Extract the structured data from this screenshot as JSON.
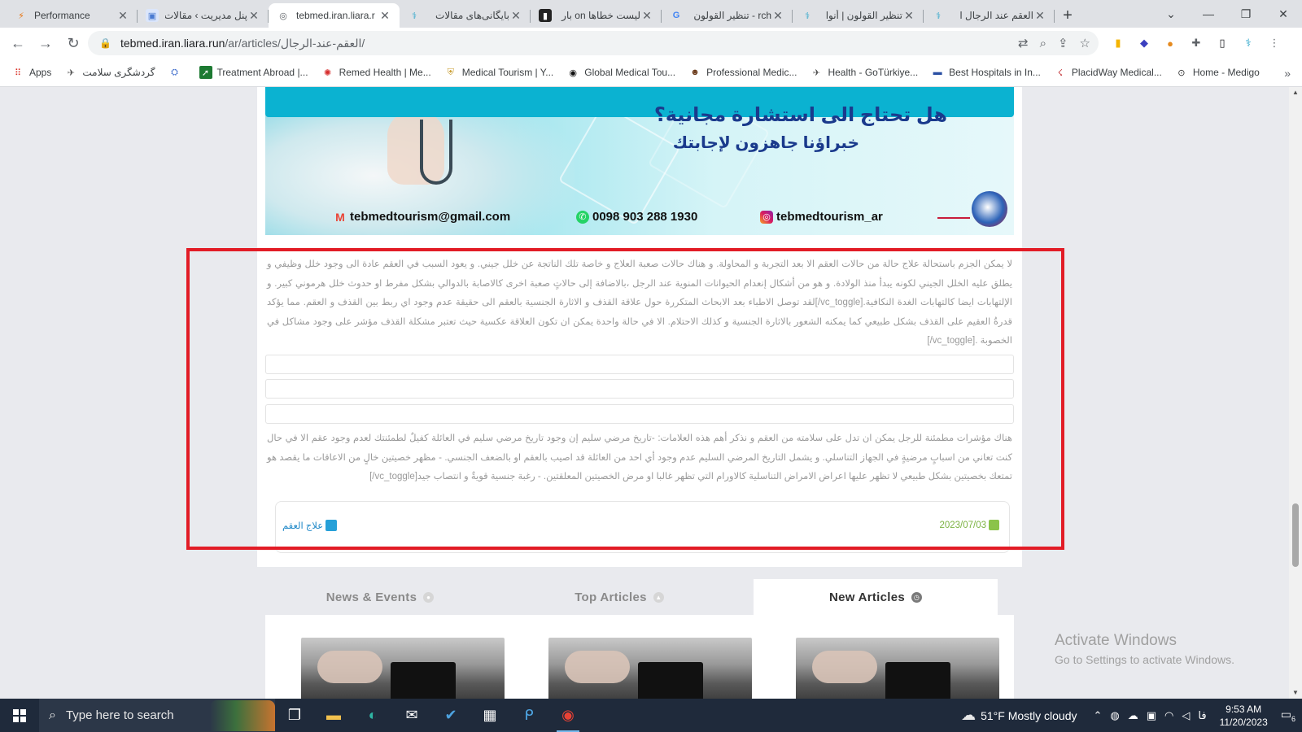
{
  "browser": {
    "tabs": [
      {
        "title": "Performance",
        "icon": "performance-icon",
        "color": "#e8710a"
      },
      {
        "title": "پنل مدیریت › مقالات",
        "icon": "site-icon",
        "color": "#4a7bd1"
      },
      {
        "title": "tebmed.iran.liara.r",
        "icon": "globe-icon",
        "color": "#5f6368",
        "active": true
      },
      {
        "title": "بایگانی‌های مقالات",
        "icon": "tebmed-icon",
        "color": "#27a3c9"
      },
      {
        "title": "لیست خطاها on بار",
        "icon": "doc-icon",
        "color": "#222222"
      },
      {
        "title": "rch - تنظیر القولون",
        "icon": "google-icon",
        "color": "#4285f4"
      },
      {
        "title": "تنظیر القولون | أنوا",
        "icon": "tebmed-icon",
        "color": "#27a3c9"
      },
      {
        "title": "العقم عند الرجال ا",
        "icon": "tebmed-icon",
        "color": "#27a3c9"
      }
    ],
    "new_tab": "+",
    "url_host": "tebmed.iran.liara.run",
    "url_path": "/ar/articles/العقم-عند-الرجال/",
    "bookmarks": [
      {
        "label": "Apps",
        "icon": "apps-grid-icon"
      },
      {
        "label": "گردشگری سلامت",
        "icon": "tourism-icon"
      },
      {
        "label": "",
        "icon": "badge-icon"
      },
      {
        "label": "Treatment Abroad |...",
        "icon": "treatment-abroad-icon"
      },
      {
        "label": "Remed Health | Me...",
        "icon": "remed-icon"
      },
      {
        "label": "Medical Tourism | Y...",
        "icon": "shield-icon"
      },
      {
        "label": "Global Medical Tou...",
        "icon": "global-icon"
      },
      {
        "label": "Professional Medic...",
        "icon": "person-icon"
      },
      {
        "label": "Health - GoTürkiye...",
        "icon": "plane-icon"
      },
      {
        "label": "Best Hospitals in In...",
        "icon": "hospital-icon"
      },
      {
        "label": "PlacidWay Medical...",
        "icon": "placidway-icon"
      },
      {
        "label": "Home - Medigo",
        "icon": "pin-icon"
      }
    ]
  },
  "banner": {
    "headline": "هل تحتاج الى استشارة مجانية؟",
    "subheadline": "خبراؤنا جاهزون لإجابتك",
    "email": "tebmedtourism@gmail.com",
    "phone": "0098 903 288 1930",
    "instagram": "tebmedtourism_ar"
  },
  "article": {
    "paragraph1": "لا يمكن الجزم باستحالة علاج حالة من حالات العقم الا بعد التجربة و المحاولة. و هناك حالات صعبة العلاج و خاصة تلك الناتجة عن خلل جيني. و يعود السبب في العقم عادة الى وجود خلل وظيفي و يطلق عليه الخلل الجيني لكونه يبدأ منذ الولادة. و هو من أشكال إنعدام الحيوانات المنوية عند الرجل ،بالاضافة إلى حالاتٍ صعبة اخرى كالاصابة بالدوالي بشكل مفرط او حدوث خلل هرموني كبير. و الإلتهابات ايضا كالتهابات الغدة النكافية.[vc_toggle/]لقد توصل الاطباء بعد الابحاث المتكررة حول علاقة القذف و الاثارة الجنسية بالعقم الى حقيقة عدم وجود اي ربط بين القذف و العقم. مما يؤكد قدرةُ العقيم على القذف بشكل طبيعي كما يمكنه الشعور بالاثارة الجنسية و كذلك الاحتلام. الا في حالة واحدة يمكن ان تكون العلاقة عكسية حيث تعتبر مشكلة القذف مؤشر على وجود مشاكل في الخصوبة .[vc_toggle/]",
    "paragraph2": "هناك مؤشرات مطمئنة للرجل يمكن ان تدل على سلامته من العقم و نذكر أهم هذه العلامات: -تاريخ مرضي سليم إن وجود تاريخ مرضي سليم في العائلة كفيلٌ لطمئنتك لعدم وجود عقم الا في حال كنت تعاني من اسبابٍ مرضيةٍ في الجهاز التناسلي. و يشمل التاريخ المرضي السليم عدم وجود أي احد من العائلة قد اصيب بالعقم او بالضعف الجنسي. - مظهر خصيتين خالٍ من الاعاقات ما يقصد هو تمتعك بخصيتين بشكل طبيعي لا تظهر عليها اعراض الامراض التناسلية كالاورام التي تظهر غالبا او مرض الخصيتين المعلقتين. - رغبة جنسية قويةٌ و انتصاب جيد[vc_toggle/]",
    "date": "2023/07/03",
    "category": "علاج العقم"
  },
  "article_tabs": [
    {
      "label": "News & Events",
      "icon": "bulb-icon",
      "active": false
    },
    {
      "label": "Top Articles",
      "icon": "star-icon",
      "active": false
    },
    {
      "label": "New Articles",
      "icon": "clock-icon",
      "active": true
    }
  ],
  "watermark": {
    "line1": "Activate Windows",
    "line2": "Go to Settings to activate Windows."
  },
  "taskbar": {
    "search_placeholder": "Type here to search",
    "weather": "51°F  Mostly cloudy",
    "lang": "فا",
    "time": "9:53 AM",
    "date": "11/20/2023",
    "notifications": "6"
  },
  "colors": {
    "accent": "#0bb2d1",
    "highlight": "#e21c26",
    "date": "#7cb342",
    "category": "#1e88c8"
  }
}
